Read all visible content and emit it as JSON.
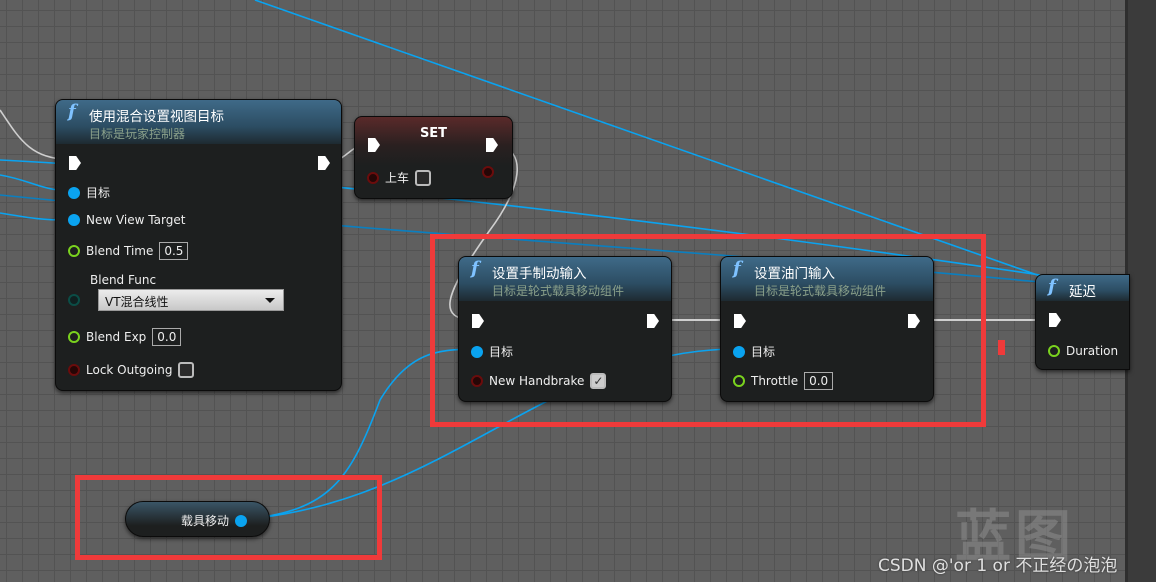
{
  "nodes": {
    "set_view_target": {
      "title": "使用混合设置视图目标",
      "subtitle": "目标是玩家控制器",
      "pins": {
        "target": "目标",
        "new_view_target": "New View Target",
        "blend_time": "Blend Time",
        "blend_time_value": "0.5",
        "blend_func": "Blend Func",
        "blend_func_value": "VT混合线性",
        "blend_exp": "Blend Exp",
        "blend_exp_value": "0.0",
        "lock_outgoing": "Lock Outgoing"
      },
      "lock_outgoing_checked": false
    },
    "set": {
      "title": "SET",
      "pin": "上车",
      "checked": false
    },
    "set_handbrake": {
      "title": "设置手制动输入",
      "subtitle": "目标是轮式载具移动组件",
      "pins": {
        "target": "目标",
        "new_handbrake": "New Handbrake"
      },
      "handbrake_checked": true
    },
    "set_throttle": {
      "title": "设置油门输入",
      "subtitle": "目标是轮式载具移动组件",
      "pins": {
        "target": "目标",
        "throttle": "Throttle",
        "throttle_value": "0.0"
      }
    },
    "delay": {
      "title": "延迟",
      "pins": {
        "duration": "Duration"
      }
    },
    "vehicle_movement": {
      "label": "载具移动"
    }
  },
  "watermark": "蓝图",
  "credit": "CSDN @'or 1 or 不正经の泡泡",
  "colors": {
    "highlight": "#f03a3a",
    "object_pin": "#0aa3f0",
    "float_pin": "#7ad21e",
    "bool_pin": "#6b0c0c"
  }
}
